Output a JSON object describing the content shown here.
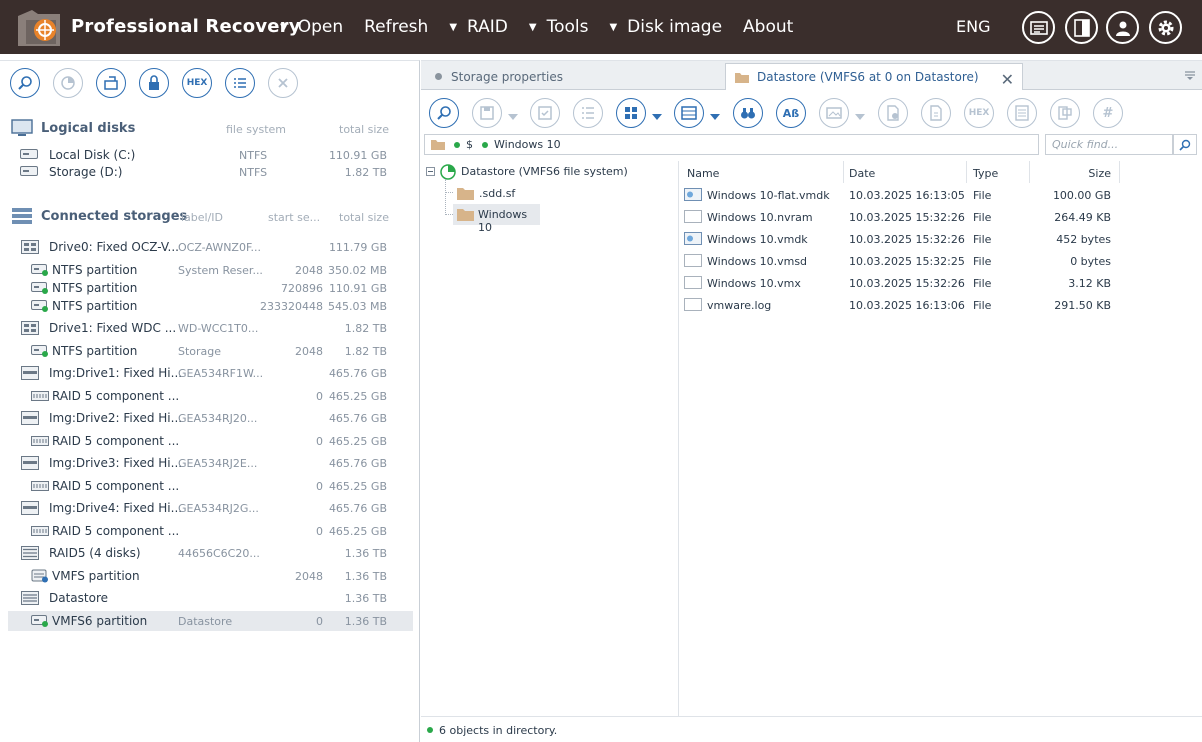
{
  "app": {
    "title": "Professional Recovery",
    "menu": [
      {
        "label": "Open",
        "has_dropdown": true
      },
      {
        "label": "Refresh",
        "has_dropdown": false
      },
      {
        "label": "RAID",
        "has_dropdown": true
      },
      {
        "label": "Tools",
        "has_dropdown": true
      },
      {
        "label": "Disk image",
        "has_dropdown": true
      },
      {
        "label": "About",
        "has_dropdown": false
      }
    ],
    "language": "ENG",
    "header_icons": [
      "card-icon",
      "panel-icon",
      "user-icon",
      "settings-icon"
    ]
  },
  "left": {
    "toolbar_icons": [
      "search-icon",
      "scan-icon",
      "disk-image-icon",
      "lock-icon",
      "hex-icon",
      "list-icon",
      "close-icon"
    ],
    "hex_label": "HEX",
    "logical": {
      "title": "Logical disks",
      "col_fs": "file system",
      "col_size": "total size",
      "items": [
        {
          "name": "Local Disk (C:)",
          "fs": "NTFS",
          "size": "110.91 GB"
        },
        {
          "name": "Storage (D:)",
          "fs": "NTFS",
          "size": "1.82 TB"
        }
      ]
    },
    "connected": {
      "title": "Connected storages",
      "col_label": "label/ID",
      "col_start": "start se...",
      "col_size": "total size",
      "items": [
        {
          "name": "Drive0: Fixed OCZ-V...",
          "label": "OCZ-AWNZ0F...",
          "start": "",
          "size": "111.79 GB",
          "level": 0,
          "icon": "drive"
        },
        {
          "name": "NTFS partition",
          "label": "System Reser...",
          "start": "2048",
          "size": "350.02 MB",
          "level": 1,
          "icon": "partition"
        },
        {
          "name": "NTFS partition",
          "label": "",
          "start": "720896",
          "size": "110.91 GB",
          "level": 1,
          "icon": "partition"
        },
        {
          "name": "NTFS partition",
          "label": "",
          "start": "233320448",
          "size": "545.03 MB",
          "level": 1,
          "icon": "partition"
        },
        {
          "name": "Drive1: Fixed WDC ...",
          "label": "WD-WCC1T0...",
          "start": "",
          "size": "1.82 TB",
          "level": 0,
          "icon": "drive"
        },
        {
          "name": "NTFS partition",
          "label": "Storage",
          "start": "2048",
          "size": "1.82 TB",
          "level": 1,
          "icon": "partition"
        },
        {
          "name": "Img:Drive1: Fixed Hi...",
          "label": "GEA534RF1W...",
          "start": "",
          "size": "465.76 GB",
          "level": 0,
          "icon": "image"
        },
        {
          "name": "RAID 5 component ...",
          "label": "",
          "start": "0",
          "size": "465.25 GB",
          "level": 1,
          "icon": "raid-component"
        },
        {
          "name": "Img:Drive2: Fixed Hi...",
          "label": "GEA534RJ20...",
          "start": "",
          "size": "465.76 GB",
          "level": 0,
          "icon": "image"
        },
        {
          "name": "RAID 5 component ...",
          "label": "",
          "start": "0",
          "size": "465.25 GB",
          "level": 1,
          "icon": "raid-component"
        },
        {
          "name": "Img:Drive3: Fixed Hi...",
          "label": "GEA534RJ2E...",
          "start": "",
          "size": "465.76 GB",
          "level": 0,
          "icon": "image"
        },
        {
          "name": "RAID 5 component ...",
          "label": "",
          "start": "0",
          "size": "465.25 GB",
          "level": 1,
          "icon": "raid-component"
        },
        {
          "name": "Img:Drive4: Fixed Hi...",
          "label": "GEA534RJ2G...",
          "start": "",
          "size": "465.76 GB",
          "level": 0,
          "icon": "image"
        },
        {
          "name": "RAID 5 component ...",
          "label": "",
          "start": "0",
          "size": "465.25 GB",
          "level": 1,
          "icon": "raid-component"
        },
        {
          "name": "RAID5 (4 disks)",
          "label": "44656C6C20...",
          "start": "",
          "size": "1.36 TB",
          "level": 0,
          "icon": "raid"
        },
        {
          "name": "VMFS partition",
          "label": "",
          "start": "2048",
          "size": "1.36 TB",
          "level": 1,
          "icon": "vmfs-partition"
        },
        {
          "name": "Datastore",
          "label": "",
          "start": "",
          "size": "1.36 TB",
          "level": 0,
          "icon": "datastore"
        },
        {
          "name": "VMFS6 partition",
          "label": "Datastore",
          "start": "0",
          "size": "1.36 TB",
          "level": 1,
          "icon": "partition",
          "selected": true
        }
      ]
    }
  },
  "right": {
    "tabs": [
      {
        "label": "Storage properties",
        "active": false
      },
      {
        "label": "Datastore (VMFS6 at 0 on Datastore)",
        "active": true
      }
    ],
    "toolbar_icons": [
      "search-icon",
      "save-icon",
      "save-dropdown-icon",
      "save-marked-icon",
      "checklist-icon",
      "view-mode-icon",
      "view-mode-dropdown-icon",
      "panel-view-icon",
      "panel-view-dropdown-icon",
      "binoculars-icon",
      "rename-icon",
      "preview-icon",
      "preview-dropdown-icon",
      "file-props-icon",
      "file-info-icon",
      "hex-icon",
      "text-view-icon",
      "bookmarks-icon",
      "hash-icon"
    ],
    "hex_label": "HEX",
    "rename_label": "Aß",
    "hash_label": "#",
    "path": [
      "$",
      "Windows 10"
    ],
    "search_placeholder": "Quick find...",
    "tree": {
      "root": "Datastore (VMFS6 file system)",
      "children": [
        ".sdd.sf",
        "Windows 10"
      ]
    },
    "columns": {
      "name": "Name",
      "date": "Date",
      "type": "Type",
      "size": "Size"
    },
    "files": [
      {
        "name": "Windows 10-flat.vmdk",
        "date": "10.03.2025 16:13:05",
        "type": "File",
        "size": "100.00 GB",
        "icon": "disk-file"
      },
      {
        "name": "Windows 10.nvram",
        "date": "10.03.2025 15:32:26",
        "type": "File",
        "size": "264.49 KB",
        "icon": "file"
      },
      {
        "name": "Windows 10.vmdk",
        "date": "10.03.2025 15:32:26",
        "type": "File",
        "size": "452 bytes",
        "icon": "disk-file"
      },
      {
        "name": "Windows 10.vmsd",
        "date": "10.03.2025 15:32:25",
        "type": "File",
        "size": "0 bytes",
        "icon": "file"
      },
      {
        "name": "Windows 10.vmx",
        "date": "10.03.2025 15:32:26",
        "type": "File",
        "size": "3.12 KB",
        "icon": "file"
      },
      {
        "name": "vmware.log",
        "date": "10.03.2025 16:13:06",
        "type": "File",
        "size": "291.50 KB",
        "icon": "file"
      }
    ],
    "status": "6 objects in directory."
  },
  "colors": {
    "header_bg": "#3a2e2c",
    "accent": "#2f6fb3",
    "logo_orange": "#e8832a",
    "ok_green": "#2aa84a"
  }
}
